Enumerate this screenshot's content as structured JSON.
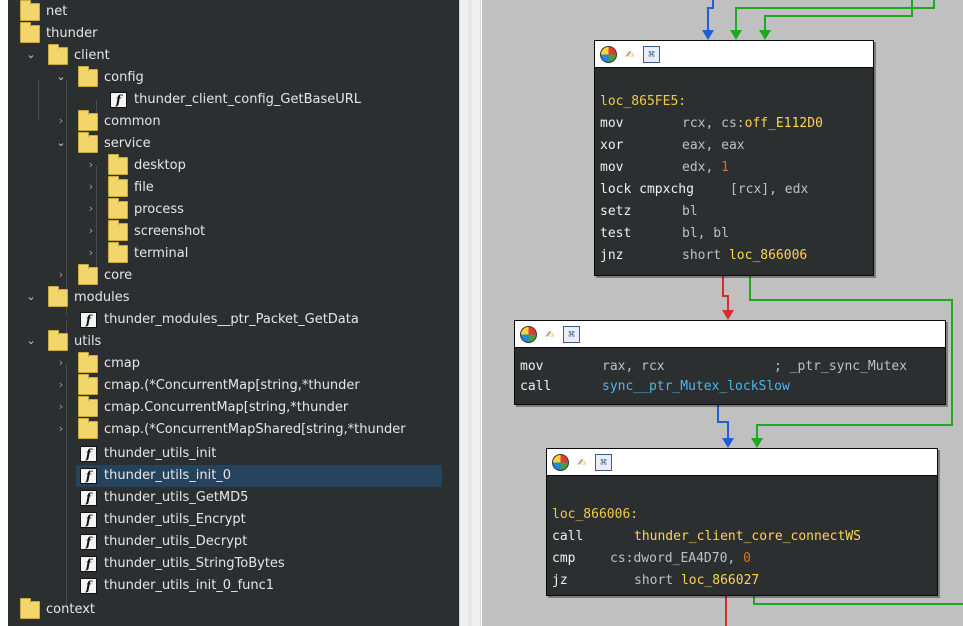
{
  "tree": {
    "items": [
      {
        "label": "net",
        "type": "folder"
      },
      {
        "label": "thunder",
        "type": "folder"
      },
      {
        "label": "client",
        "type": "folder"
      },
      {
        "label": "config",
        "type": "folder"
      },
      {
        "label": "thunder_client_config_GetBaseURL",
        "type": "function"
      },
      {
        "label": "common",
        "type": "folder"
      },
      {
        "label": "service",
        "type": "folder"
      },
      {
        "label": "desktop",
        "type": "folder"
      },
      {
        "label": "file",
        "type": "folder"
      },
      {
        "label": "process",
        "type": "folder"
      },
      {
        "label": "screenshot",
        "type": "folder"
      },
      {
        "label": "terminal",
        "type": "folder"
      },
      {
        "label": "core",
        "type": "folder"
      },
      {
        "label": "modules",
        "type": "folder"
      },
      {
        "label": "thunder_modules__ptr_Packet_GetData",
        "type": "function"
      },
      {
        "label": "utils",
        "type": "folder"
      },
      {
        "label": "cmap",
        "type": "folder"
      },
      {
        "label": "cmap.(*ConcurrentMap[string,*thunder",
        "type": "folder"
      },
      {
        "label": "cmap.ConcurrentMap[string,*thunder",
        "type": "folder"
      },
      {
        "label": "cmap.(*ConcurrentMapShared[string,*thunder",
        "type": "folder"
      },
      {
        "label": "thunder_utils_init",
        "type": "function"
      },
      {
        "label": "thunder_utils_init_0",
        "type": "function",
        "selected": true
      },
      {
        "label": "thunder_utils_GetMD5",
        "type": "function"
      },
      {
        "label": "thunder_utils_Encrypt",
        "type": "function"
      },
      {
        "label": "thunder_utils_Decrypt",
        "type": "function"
      },
      {
        "label": "thunder_utils_StringToBytes",
        "type": "function"
      },
      {
        "label": "thunder_utils_init_0_func1",
        "type": "function"
      },
      {
        "label": "context",
        "type": "folder"
      }
    ]
  },
  "graph": {
    "block1": {
      "label": "loc_865FE5:",
      "lines": [
        {
          "m": "mov",
          "pre": "rcx, cs:",
          "ref": "off_E112D0"
        },
        {
          "m": "xor",
          "pre": "eax, eax"
        },
        {
          "m": "mov",
          "pre": "edx, ",
          "num": "1"
        },
        {
          "m": "lock cmpxchg",
          "pre": "[rcx], edx"
        },
        {
          "m": "setz",
          "pre": "bl"
        },
        {
          "m": "test",
          "pre": "bl, bl"
        },
        {
          "m": "jnz",
          "pre": "short ",
          "ref": "loc_866006"
        }
      ]
    },
    "block2": {
      "lines": [
        {
          "m": "mov",
          "pre": "rax, rcx",
          "comment": "; _ptr_sync_Mutex"
        },
        {
          "m": "call",
          "target": "sync__ptr_Mutex_lockSlow"
        }
      ]
    },
    "block3": {
      "label": "loc_866006:",
      "lines": [
        {
          "m": "call",
          "target": "thunder_client_core_connectWS"
        },
        {
          "m": "cmp",
          "pre": "cs:dword_EA4D70, ",
          "num": "0"
        },
        {
          "m": "jz",
          "pre": "short ",
          "ref": "loc_866027"
        }
      ]
    },
    "header_icons": [
      "color-wheel-icon",
      "edit-icon",
      "graph-icon"
    ],
    "colors": {
      "edge_true": "#1ea81e",
      "edge_false": "#d32f2f",
      "edge_jump": "#1f5fd6"
    }
  }
}
